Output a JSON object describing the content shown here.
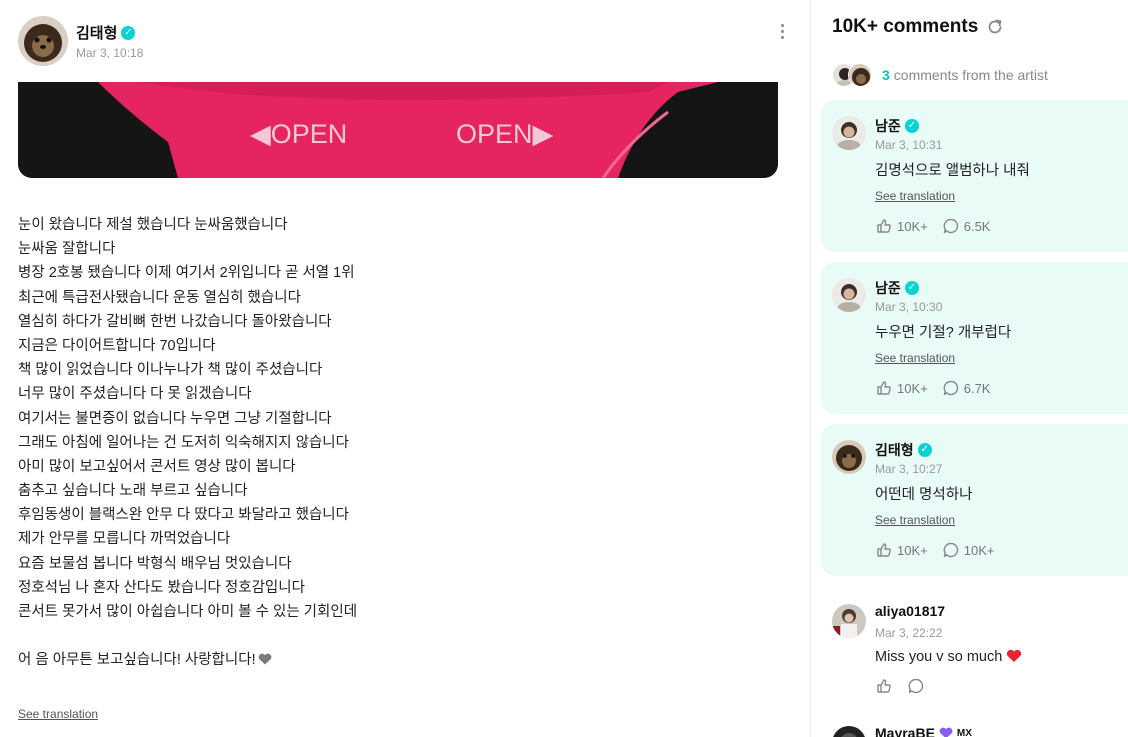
{
  "post": {
    "author": "김태형",
    "timestamp": "Mar 3, 10:18",
    "image_labels": [
      "◀OPEN",
      "OPEN▶"
    ],
    "lines": [
      "눈이 왔습니다 제설 했습니다 눈싸움했습니다",
      "눈싸움 잘합니다",
      "병장 2호봉 됐습니다 이제 여기서 2위입니다 곧 서열 1위",
      "최근에 특급전사됐습니다 운동 열심히 했습니다",
      "열심히 하다가 갈비뼈 한번 나갔습니다 돌아왔습니다",
      "지금은 다이어트합니다 70입니다",
      "책 많이 읽었습니다 이나누나가 책 많이 주셨습니다",
      "너무 많이 주셨습니다 다 못 읽겠습니다",
      "여기서는 불면증이 없습니다 누우면 그냥 기절합니다",
      "그래도 아침에 일어나는 건 도저히 익숙해지지 않습니다",
      "아미 많이 보고싶어서 콘서트 영상 많이 봅니다",
      "춤추고 싶습니다 노래 부르고 싶습니다",
      "후임동생이 블랙스완 안무 다 땄다고 봐달라고 했습니다",
      "제가 안무를 모릅니다 까먹었습니다",
      "요즘 보물섬 봅니다 박형식 배우님 멋있습니다",
      "정호석님 나 혼자 산다도 봤습니다 정호감입니다",
      "콘서트 못가서 많이 아쉽습니다 아미 볼 수 있는 기회인데"
    ],
    "closing_line": "어 음 아무튼 보고싶습니다! 사랑합니다!",
    "see_translation": "See translation"
  },
  "comments_panel": {
    "title": "10K+ comments",
    "artist_count": "3",
    "artist_label": "comments from the artist",
    "artist_comments": [
      {
        "name": "남준",
        "time": "Mar 3, 10:31",
        "text": "김명석으로 앨범하나 내줘",
        "see_translation": "See translation",
        "likes": "10K+",
        "replies": "6.5K"
      },
      {
        "name": "남준",
        "time": "Mar 3, 10:30",
        "text": "누우면 기절? 개부럽다",
        "see_translation": "See translation",
        "likes": "10K+",
        "replies": "6.7K"
      },
      {
        "name": "김태형",
        "time": "Mar 3, 10:27",
        "text": "어떤데 명석하나",
        "see_translation": "See translation",
        "likes": "10K+",
        "replies": "10K+"
      }
    ],
    "fan_comments": [
      {
        "name": "aliya01817",
        "time": "Mar 3, 22:22",
        "text": "Miss you v so much"
      },
      {
        "name": "MayraBE",
        "badge": "MX"
      }
    ]
  },
  "colors": {
    "verified": "#07d3d3",
    "artist_card_bg": "#e8fbf6",
    "accent_count": "#07c4c4",
    "heart_red": "#e8222e",
    "heart_gray": "#7a7a7a",
    "purple_heart": "#8a5cf5"
  },
  "icons": {
    "verified": "verified-badge-icon",
    "refresh": "refresh-icon",
    "like": "like-hand-icon",
    "reply": "comment-bubble-icon",
    "more": "more-vertical-icon"
  }
}
